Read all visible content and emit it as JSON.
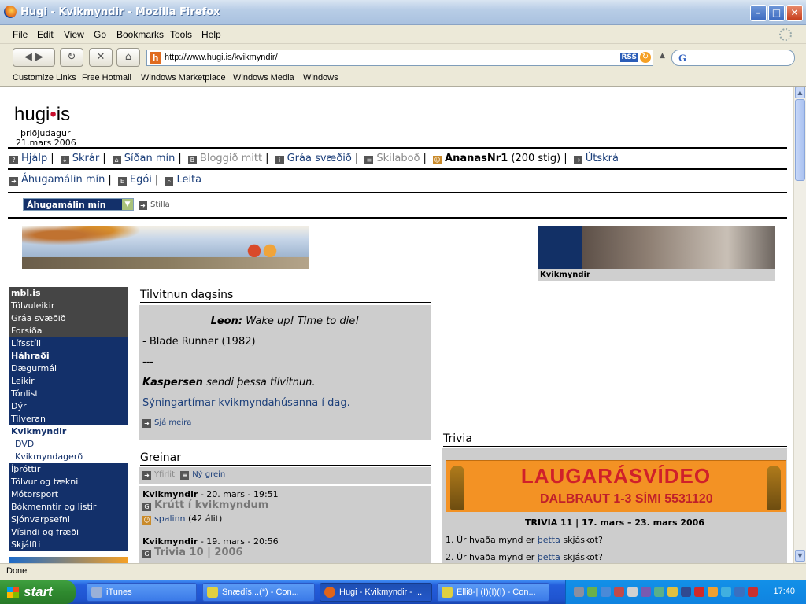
{
  "window": {
    "title": "Hugi - Kvikmyndir - Mozilla Firefox"
  },
  "menu": [
    "File",
    "Edit",
    "View",
    "Go",
    "Bookmarks",
    "Tools",
    "Help"
  ],
  "nav": {
    "url": "http://www.hugi.is/kvikmyndir/",
    "rss": "RSS",
    "search_glyph": "G"
  },
  "links": [
    "Customize Links",
    "Free Hotmail",
    "Windows Marketplace",
    "Windows Media",
    "Windows"
  ],
  "page": {
    "logo_left": "hugi",
    "logo_dot": "•",
    "logo_right": "is",
    "day": "þriðjudagur",
    "date": "21.mars 2006",
    "top_nav": {
      "hjalp": "Hjálp",
      "skrar": "Skrár",
      "sidan": "Síðan mín",
      "blogg": "Bloggið mitt",
      "graa": "Gráa svæðið",
      "skilabod": "Skilaboð",
      "user": "AnanasNr1",
      "points": "(200 stig)",
      "utskra": "Útskrá"
    },
    "second_nav": {
      "ahugamal": "Áhugamálin mín",
      "egoi": "Egói",
      "leita": "Leita"
    },
    "select": {
      "value": "Áhugamálin mín",
      "button": "Stilla"
    },
    "banner_caption": "Kvikmyndir",
    "left_menu": [
      {
        "label": "mbl.is",
        "style": "dark",
        "bold": true
      },
      {
        "label": "Tölvuleikir",
        "style": "dark"
      },
      {
        "label": "Gráa svæðið",
        "style": "dark"
      },
      {
        "label": "Forsíða",
        "style": "dark"
      },
      {
        "label": "Lífsstíll",
        "style": "blue"
      },
      {
        "label": "Háhraði",
        "style": "blue",
        "bold": true
      },
      {
        "label": "Dægurmál",
        "style": "blue"
      },
      {
        "label": "Leikir",
        "style": "blue"
      },
      {
        "label": "Tónlist",
        "style": "blue"
      },
      {
        "label": "Dýr",
        "style": "blue"
      },
      {
        "label": "Tilveran",
        "style": "blue"
      },
      {
        "label": "Kvikmyndir",
        "style": "white",
        "bold": true
      },
      {
        "label": "DVD",
        "style": "white",
        "sub": true
      },
      {
        "label": "Kvikmyndagerð",
        "style": "white",
        "sub": true
      },
      {
        "label": "Íþróttir",
        "style": "blue"
      },
      {
        "label": "Tölvur og tækni",
        "style": "blue"
      },
      {
        "label": "Mótorsport",
        "style": "blue"
      },
      {
        "label": "Bókmenntir og listir",
        "style": "blue"
      },
      {
        "label": "Sjónvarpsefni",
        "style": "blue"
      },
      {
        "label": "Vísindi og fræði",
        "style": "blue"
      },
      {
        "label": "Skjálfti",
        "style": "blue"
      }
    ],
    "quote_section": {
      "heading": "Tilvitnun dagsins",
      "speaker": "Leon:",
      "line": "Wake up! Time to die!",
      "source": "- Blade Runner (1982)",
      "divider": "---",
      "sender": "Kaspersen",
      "sent_text": "sendi þessa tilvitnun.",
      "showtimes": "Sýningartímar kvikmyndahúsanna í dag.",
      "more": "Sjá meira"
    },
    "greinar": {
      "heading": "Greinar",
      "overview": "Yfirlit",
      "new": "Ný grein",
      "items": [
        {
          "cat": "Kvikmyndir",
          "date": "- 20. mars - 19:51",
          "title": "Krútt í kvikmyndum",
          "author": "spalinn",
          "views": "(42 álit)"
        },
        {
          "cat": "Kvikmyndir",
          "date": "- 19. mars - 20:56",
          "title": "Trivia 10 | 2006"
        }
      ]
    },
    "trivia": {
      "heading": "Trivia",
      "banner_title": "LAUGARÁSVÍDEO",
      "banner_sub": "DALBRAUT 1-3   SÍMI 5531120",
      "period": "TRIVIA 11 | 17. mars – 23. mars 2006",
      "q1_pre": "1. Úr hvaða mynd er",
      "q1_link": "þetta",
      "q1_post": "skjáskot?",
      "q2_pre": "2. Úr hvaða mynd er",
      "q2_link": "þetta",
      "q2_post": "skjáskot?"
    }
  },
  "status": "Done",
  "taskbar": {
    "start": "start",
    "tasks": [
      "iTunes",
      "Snædís...(*) - Con...",
      "Hugi - Kvikmyndir - ...",
      "Elli8-| (I)(I)(I) - Con..."
    ],
    "clock": "17:40"
  }
}
